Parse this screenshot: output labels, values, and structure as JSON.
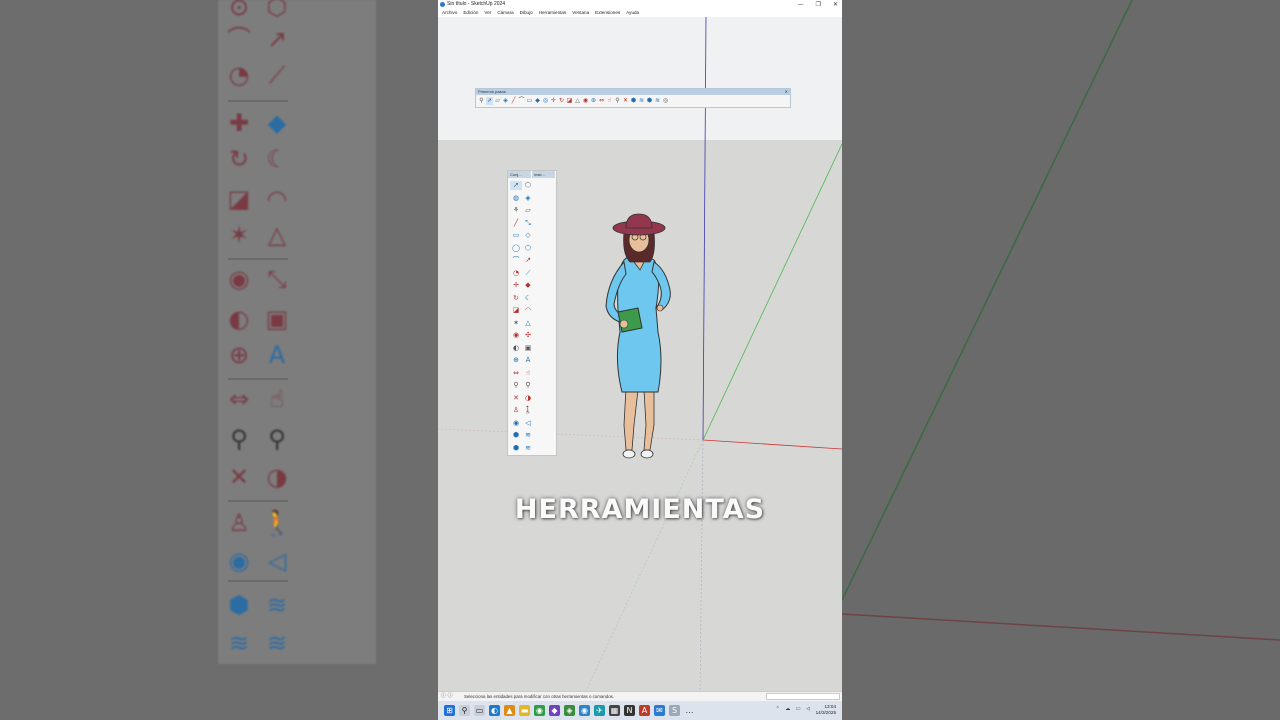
{
  "window": {
    "title": "Sin título - SketchUp 2024",
    "controls": [
      "—",
      "❐",
      "✕"
    ]
  },
  "menu": [
    "Archivo",
    "Edición",
    "Ver",
    "Cámara",
    "Dibujo",
    "Herramientas",
    "Ventana",
    "Extensiones",
    "Ayuda"
  ],
  "toolbar_primeros_pasos": {
    "title": "Primeros pasos",
    "icons": [
      "zoom-icon",
      "select-icon",
      "eraser-icon",
      "paint-bucket-icon",
      "line-icon",
      "arc-icon",
      "rectangle-icon",
      "push-pull-icon",
      "offset-icon",
      "move-icon",
      "rotate-icon",
      "scale-icon",
      "tape-measure-icon",
      "text-icon",
      "orbit-icon",
      "pan-icon",
      "zoom-extents-icon",
      "previous-view-icon",
      "3d-warehouse-icon",
      "extension-warehouse-icon",
      "layout-icon",
      "extension-manager-icon",
      "account-icon"
    ]
  },
  "toolbar_conjunto": {
    "tabs": [
      "Conj...",
      "Instr..."
    ],
    "icons": [
      "select-icon",
      "make-component-icon",
      "lasso-icon",
      "paint-bucket-icon",
      "tag-icon",
      "eraser-icon",
      "line-icon",
      "freehand-icon",
      "rectangle-icon",
      "rotated-rectangle-icon",
      "circle-icon",
      "polygon-icon",
      "arc-icon",
      "two-point-arc-icon",
      "three-point-arc-icon",
      "pie-icon",
      "move-icon",
      "push-pull-icon",
      "rotate-icon",
      "follow-me-icon",
      "scale-icon",
      "offset-icon",
      "tape-measure-icon",
      "dimension-icon",
      "protractor-icon",
      "text-icon",
      "axes-icon",
      "3d-text-icon",
      "section-plane-icon",
      "section-display-icon",
      "orbit-icon",
      "pan-icon",
      "zoom-icon",
      "zoom-window-icon",
      "zoom-extents-icon",
      "previous-icon",
      "position-camera-icon",
      "walk-icon",
      "look-around-icon",
      "advanced-camera-icon",
      "3d-warehouse-icon",
      "extension-warehouse-icon",
      "layout-send-icon",
      "extension-manager-icon"
    ]
  },
  "caption": "HERRAMIENTAS",
  "status": {
    "text": "Selecciona las entidades para modificar con otras herramientas o comandos."
  },
  "taskbar": {
    "time": "13:04",
    "date": "14/3/2025"
  }
}
